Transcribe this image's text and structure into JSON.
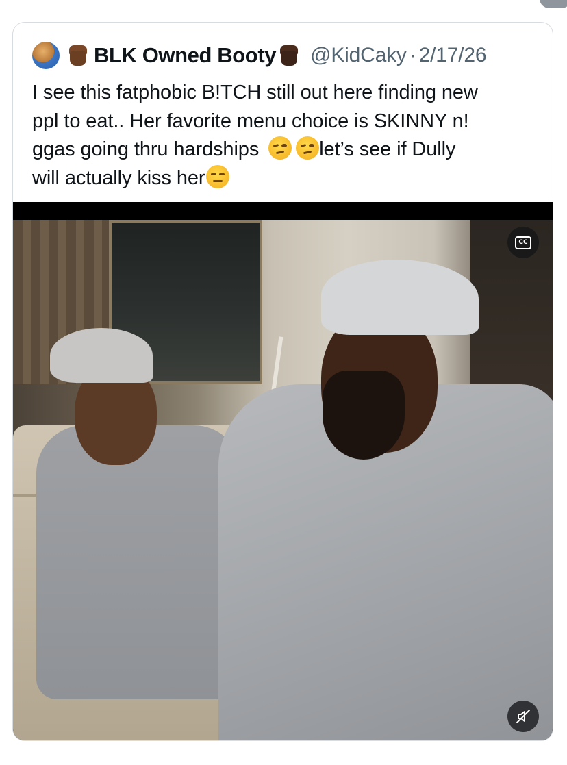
{
  "tweet": {
    "display_name": "BLK Owned Booty",
    "handle": "@KidCaky",
    "separator": "·",
    "date": "2/17/26",
    "text_lines": [
      "I see this fatphobic B!TCH still out here finding new",
      "ppl to eat.. Her favorite menu choice is SKINNY n!",
      "ggas going thru hardships",
      "let’s see if Dully",
      "will actually kiss her"
    ]
  },
  "media": {
    "cc_label": "CC",
    "cc_icon": "closed-captions-icon",
    "mute_icon": "speaker-muted-icon"
  },
  "colors": {
    "text": "#0f1419",
    "secondary": "#536471",
    "border": "#d7dce0"
  }
}
